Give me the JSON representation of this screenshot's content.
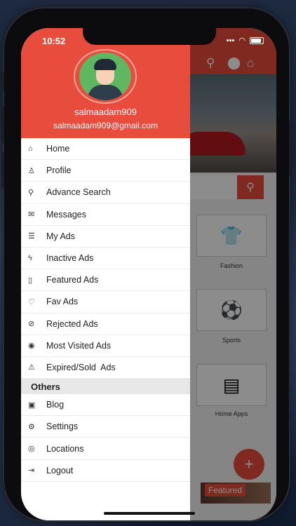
{
  "status_bar": {
    "time": "10:52"
  },
  "drawer": {
    "username": "salmaadam909",
    "email": "salmaadam909@gmail.com",
    "items": [
      {
        "label": "Home",
        "icon": "home-icon",
        "glyph": "⌂"
      },
      {
        "label": "Profile",
        "icon": "user-icon",
        "glyph": "♙"
      },
      {
        "label": "Advance Search",
        "icon": "search-icon",
        "glyph": "⚲"
      },
      {
        "label": "Messages",
        "icon": "envelope-icon",
        "glyph": "✉"
      },
      {
        "label": "My Ads",
        "icon": "list-icon",
        "glyph": "☰"
      },
      {
        "label": "Inactive Ads",
        "icon": "flash-icon",
        "glyph": "ϟ"
      },
      {
        "label": "Featured Ads",
        "icon": "bookmark-icon",
        "glyph": "▯"
      },
      {
        "label": "Fav Ads",
        "icon": "heart-icon",
        "glyph": "♡"
      },
      {
        "label": "Rejected Ads",
        "icon": "ban-icon",
        "glyph": "⊘"
      },
      {
        "label": "Most Visited Ads",
        "icon": "eye-icon",
        "glyph": "◉"
      },
      {
        "label": "Expired/Sold  Ads",
        "icon": "warning-icon",
        "glyph": "⚠"
      }
    ],
    "others_header": "Others",
    "others": [
      {
        "label": "Blog",
        "icon": "blog-icon",
        "glyph": "▣"
      },
      {
        "label": "Settings",
        "icon": "gear-icon",
        "glyph": "⚙"
      },
      {
        "label": "Locations",
        "icon": "location-icon",
        "glyph": "◎"
      },
      {
        "label": "Logout",
        "icon": "logout-icon",
        "glyph": "⇥"
      }
    ]
  },
  "background_app": {
    "categories": [
      {
        "label": "Fashion"
      },
      {
        "label": "Sports"
      },
      {
        "label": "Home Apps"
      }
    ],
    "featured_tag": "Featured",
    "fab_symbol": "+"
  },
  "colors": {
    "accent": "#e74c3c"
  }
}
